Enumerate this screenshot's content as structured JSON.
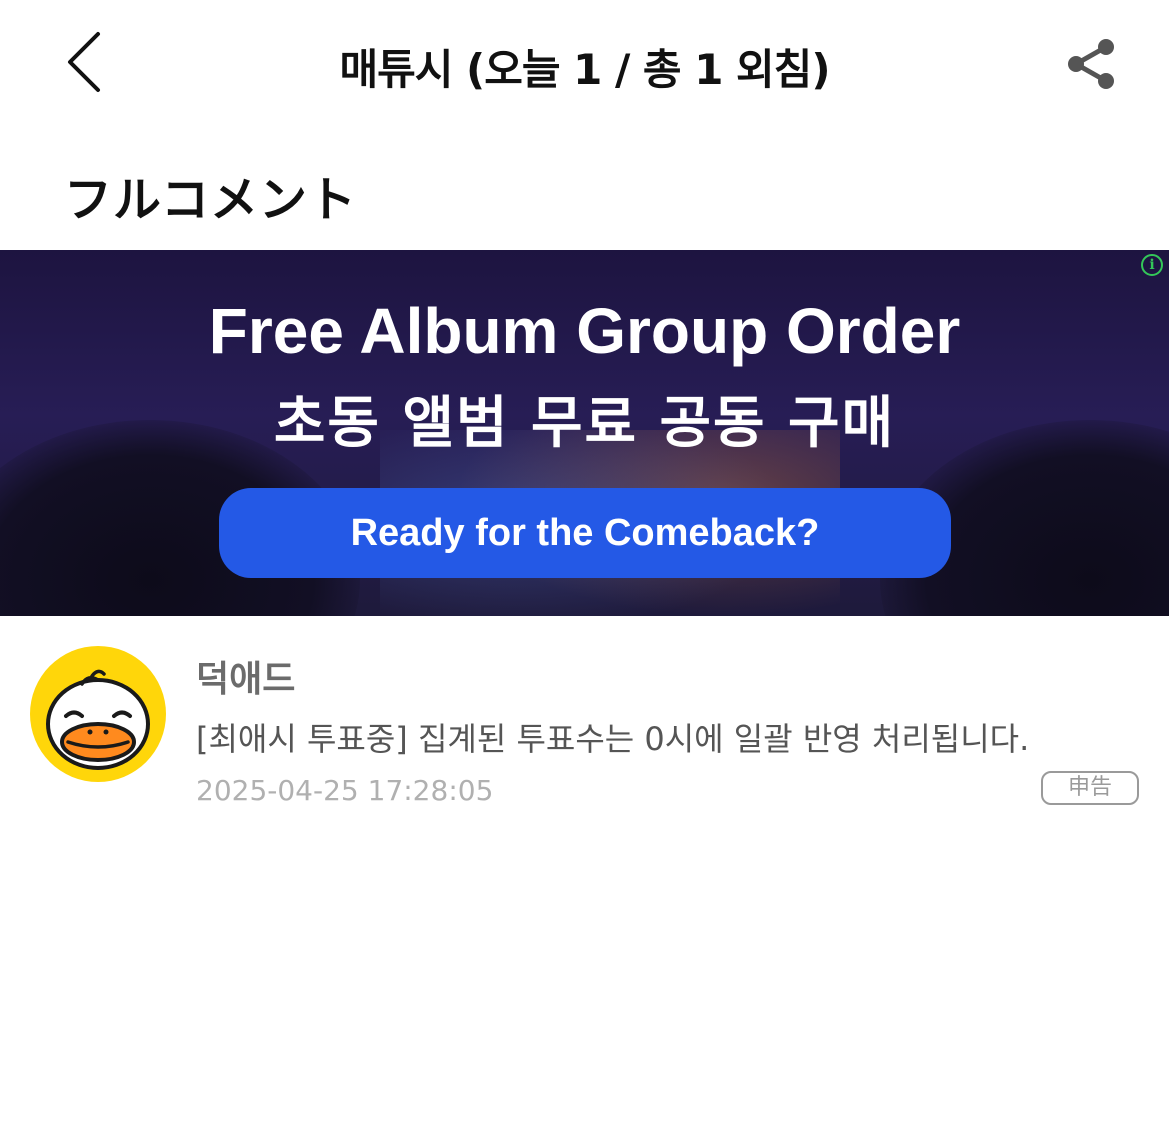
{
  "header": {
    "title": "매튜시 (오늘 1 / 총 1 외침)",
    "back_icon": "chevron-left-icon",
    "share_icon": "share-icon"
  },
  "section": {
    "title": "フルコメント"
  },
  "ad": {
    "headline": "Free Album Group Order",
    "subheadline": "초동 앨범 무료 공동 구매",
    "cta_label": "Ready for the Comeback?",
    "info_label": "i",
    "colors": {
      "cta": "#2459e6",
      "background": "#271d55",
      "info": "#34c759"
    }
  },
  "comments": [
    {
      "author": "덕애드",
      "avatar_icon": "duck-avatar-icon",
      "text": "[최애시 투표중] 집계된 투표수는 0시에 일괄 반영 처리됩니다.",
      "timestamp": "2025-04-25 17:28:05",
      "report_label": "申告"
    }
  ]
}
